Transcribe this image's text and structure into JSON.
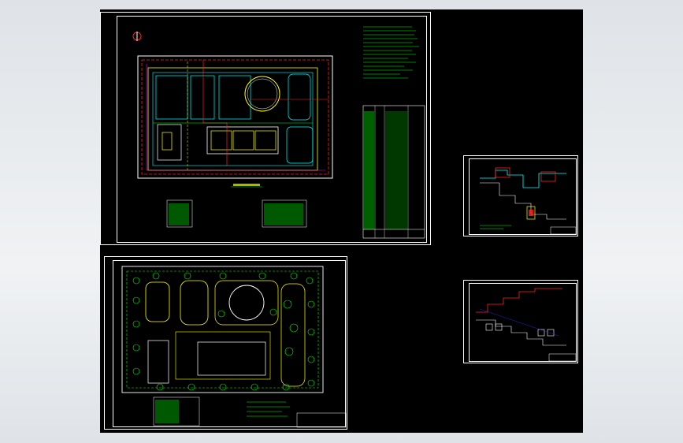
{
  "app": {
    "background": "#e9ecef",
    "canvas_color": "#000000"
  },
  "colors": {
    "border": "#ffffff",
    "red": "#ff2020",
    "yellow": "#ffff00",
    "cyan": "#00ffff",
    "green": "#00ff00",
    "magenta": "#ff00ff",
    "blue": "#3030ff"
  },
  "sheets": [
    {
      "name": "site-plan-sheet"
    },
    {
      "name": "pipe-profile-sheet"
    },
    {
      "name": "landscape-plan-sheet"
    },
    {
      "name": "elevation-profile-sheet"
    }
  ]
}
